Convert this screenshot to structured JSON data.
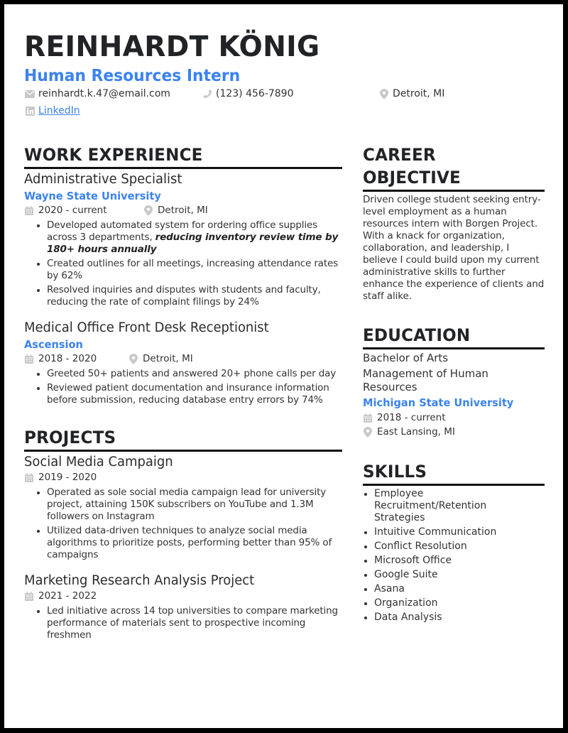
{
  "header": {
    "name": "REINHARDT KÖNIG",
    "title": "Human Resources Intern",
    "contact": {
      "email": "reinhardt.k.47@email.com",
      "phone": "(123) 456-7890",
      "location": "Detroit, MI",
      "linkedin": "LinkedIn"
    }
  },
  "icons": {
    "email": "envelope-icon",
    "phone": "phone-icon",
    "location": "map-pin-icon",
    "linkedin": "linkedin-icon",
    "date": "calendar-icon"
  },
  "colors": {
    "accent": "#3b82f0",
    "heading": "#222326",
    "rule": "#111111",
    "icon": "#c4c4c4",
    "frame": "#000000"
  },
  "work": {
    "heading": "WORK EXPERIENCE",
    "entries": [
      {
        "role": "Administrative Specialist",
        "org": "Wayne State University",
        "dates": "2020 - current",
        "location": "Detroit, MI",
        "bullets": [
          {
            "text": "Developed automated system for ordering office supplies across 3 departments, ",
            "emphasis": "reducing inventory review time by 180+ hours annually"
          },
          {
            "text": "Created outlines for all meetings, increasing attendance rates by 62%"
          },
          {
            "text": "Resolved inquiries and disputes with students and faculty, reducing the rate of complaint filings by 24%"
          }
        ]
      },
      {
        "role": "Medical Office Front Desk Receptionist",
        "org": "Ascension",
        "dates": "2018 - 2020",
        "location": "Detroit, MI",
        "bullets": [
          {
            "text": "Greeted 50+ patients and answered 20+ phone calls per day"
          },
          {
            "text": "Reviewed patient documentation and insurance information before submission, reducing database entry errors by 74%"
          }
        ]
      }
    ]
  },
  "projects": {
    "heading": "PROJECTS",
    "entries": [
      {
        "name": "Social Media Campaign",
        "dates": "2019 - 2020",
        "bullets": [
          {
            "text": "Operated as sole social media campaign lead for university project, attaining 150K subscribers on YouTube and 1.3M followers on Instagram"
          },
          {
            "text": "Utilized data-driven techniques to analyze social media algorithms to prioritize posts, performing better than 95% of campaigns"
          }
        ]
      },
      {
        "name": "Marketing Research Analysis Project",
        "dates": "2021 - 2022",
        "bullets": [
          {
            "text": "Led initiative across 14 top universities to compare marketing performance of materials sent to prospective incoming freshmen"
          }
        ]
      }
    ]
  },
  "objective": {
    "heading_line1": "CAREER",
    "heading_line2": "OBJECTIVE",
    "text": "Driven college student seeking entry-level employment as a human resources intern with Borgen Project. With a knack for organization, collaboration, and leadership, I believe I could build upon my current administrative skills to further enhance the experience of clients and staff alike."
  },
  "education": {
    "heading": "EDUCATION",
    "degree": "Bachelor of Arts",
    "field": "Management of Human Resources",
    "school": "Michigan State University",
    "dates": "2018 - current",
    "location": "East Lansing, MI"
  },
  "skills": {
    "heading": "SKILLS",
    "items": [
      "Employee Recruitment/Retention Strategies",
      "Intuitive Communication",
      "Conflict Resolution",
      "Microsoft Office",
      "Google Suite",
      "Asana",
      "Organization",
      "Data Analysis"
    ]
  }
}
